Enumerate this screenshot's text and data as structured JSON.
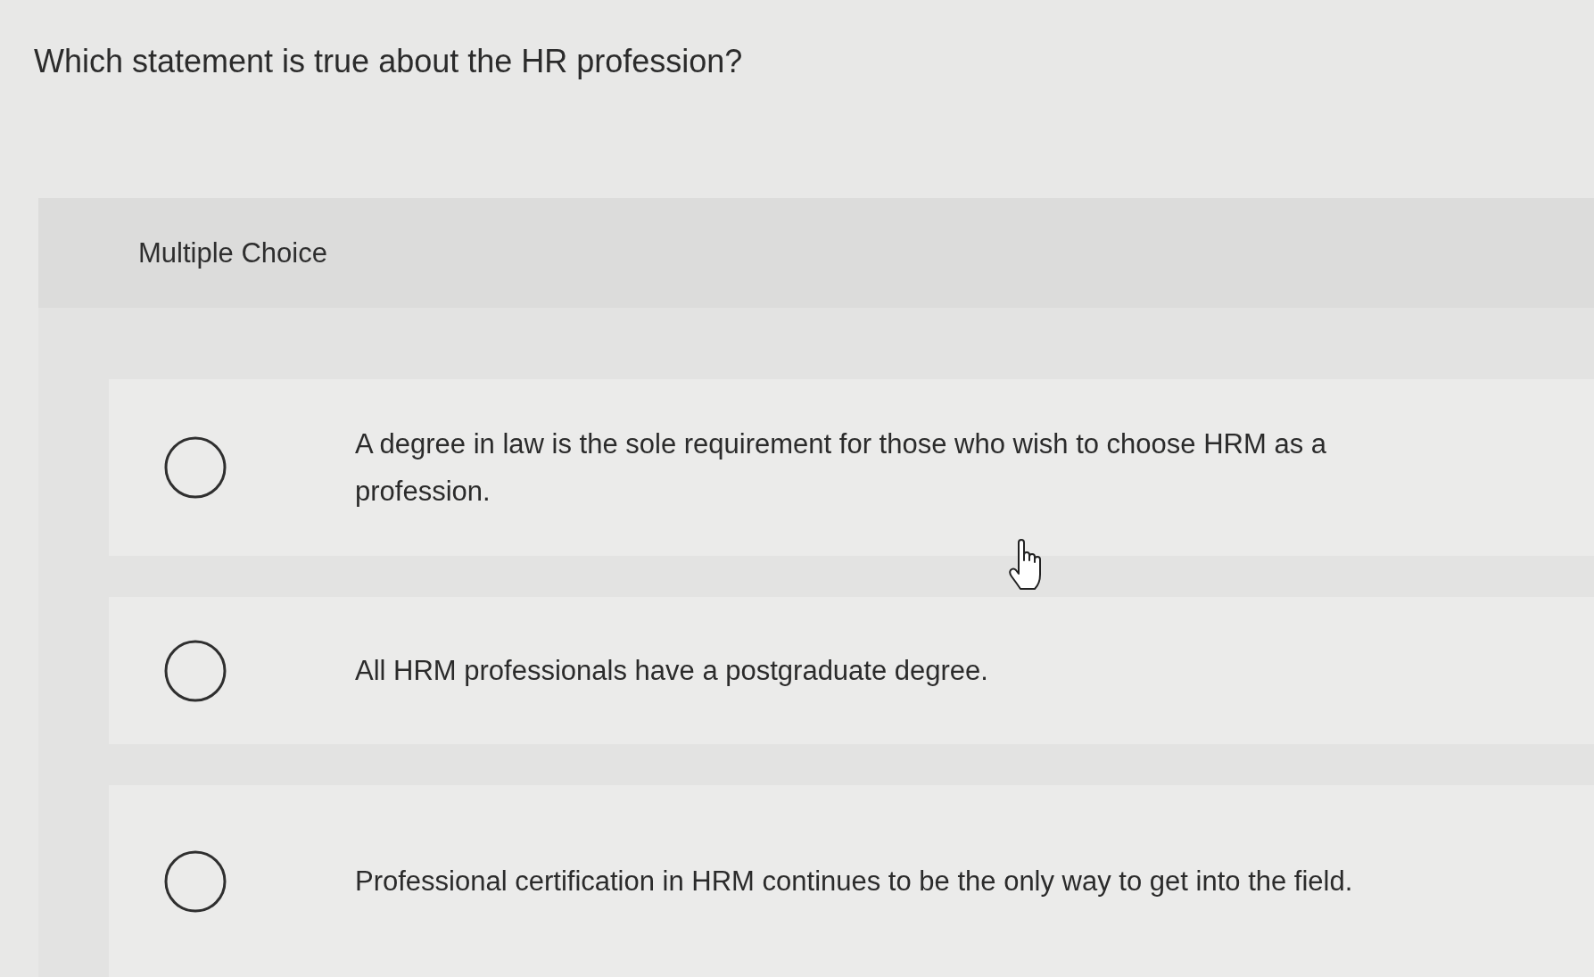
{
  "question": "Which statement is true about the HR profession?",
  "panel": {
    "heading": "Multiple Choice",
    "options": [
      {
        "text": "A degree in law is the sole requirement for those who wish to choose HRM as a profession.",
        "selected": false
      },
      {
        "text": "All HRM professionals have a postgraduate degree.",
        "selected": false
      },
      {
        "text": "Professional certification in HRM continues to be the only way to get into the field.",
        "selected": false
      }
    ]
  }
}
